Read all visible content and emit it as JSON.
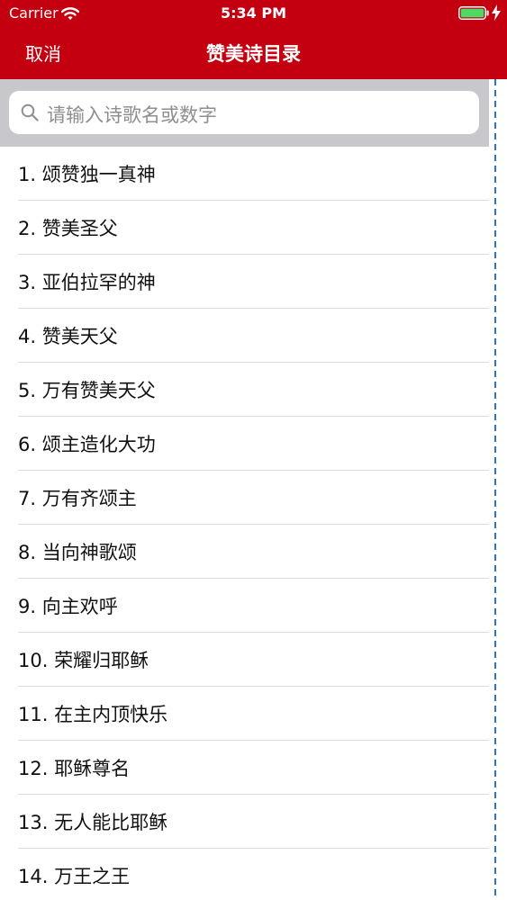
{
  "status_bar": {
    "carrier": "Carrier",
    "time": "5:34 PM"
  },
  "nav": {
    "cancel_label": "取消",
    "title": "赞美诗目录"
  },
  "search": {
    "placeholder": "请输入诗歌名或数字"
  },
  "hymns": [
    "1. 颂赞独一真神",
    "2. 赞美圣父",
    "3. 亚伯拉罕的神",
    "4. 赞美天父",
    "5. 万有赞美天父",
    "6. 颂主造化大功",
    "7. 万有齐颂主",
    "8. 当向神歌颂",
    "9. 向主欢呼",
    "10. 荣耀归耶稣",
    "11. 在主内顶快乐",
    "12. 耶稣尊名",
    "13. 无人能比耶稣",
    "14. 万王之王"
  ],
  "colors": {
    "nav_background": "#c40010",
    "search_background": "#c8c7cc",
    "index_dash": "#2f6fd6"
  }
}
